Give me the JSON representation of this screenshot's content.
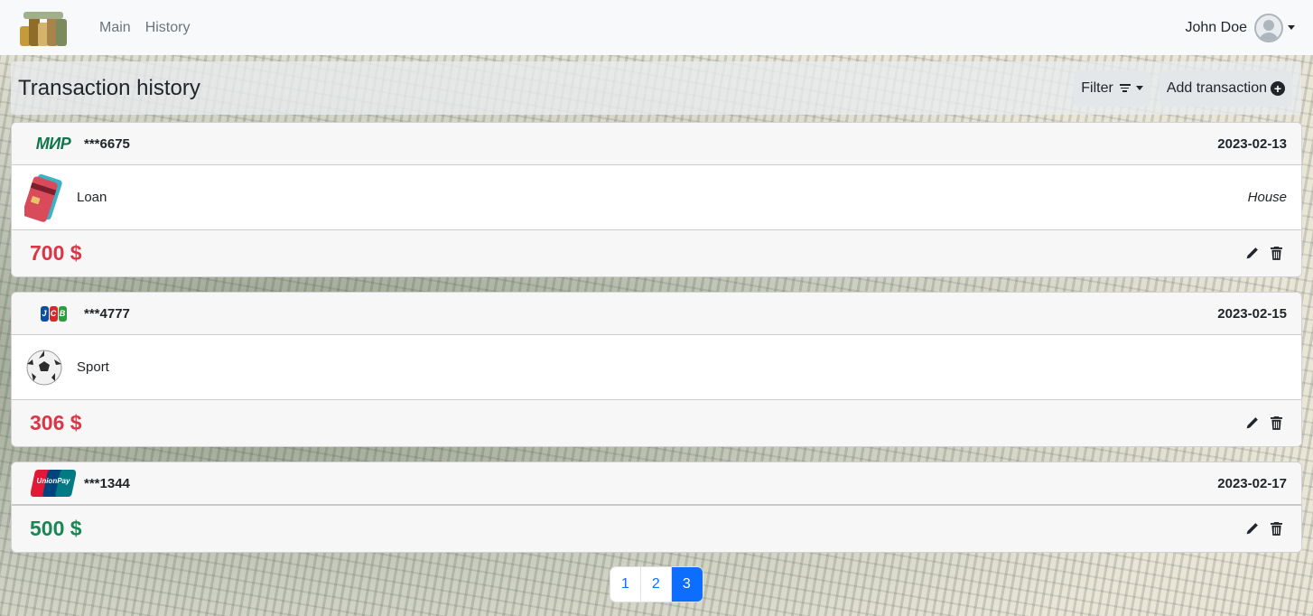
{
  "nav": {
    "links": [
      "Main",
      "History"
    ],
    "user_name": "John Doe"
  },
  "header": {
    "title": "Transaction history",
    "filter_label": "Filter",
    "add_label": "Add transaction"
  },
  "transactions": [
    {
      "card_brand": "mir-logo",
      "card_number": "***6675",
      "date": "2023-02-13",
      "category": "Loan",
      "category_icon": "credit-card-icon",
      "subcategory": "House",
      "amount": "700 $",
      "type": "expense"
    },
    {
      "card_brand": "jcb-logo",
      "card_number": "***4777",
      "date": "2023-02-15",
      "category": "Sport",
      "category_icon": "soccer-ball-icon",
      "subcategory": "",
      "amount": "306 $",
      "type": "expense"
    },
    {
      "card_brand": "unionpay-logo",
      "card_number": "***1344",
      "date": "2023-02-17",
      "amount": "500 $",
      "type": "income"
    }
  ],
  "brand_text": {
    "mir": "МИР",
    "jcb": [
      "J",
      "C",
      "B"
    ],
    "unionpay": "UnionPay"
  },
  "pagination": {
    "pages": [
      "1",
      "2",
      "3"
    ],
    "active": "3"
  },
  "colors": {
    "expense": "#dc3545",
    "income": "#198754",
    "primary": "#0d6efd"
  }
}
